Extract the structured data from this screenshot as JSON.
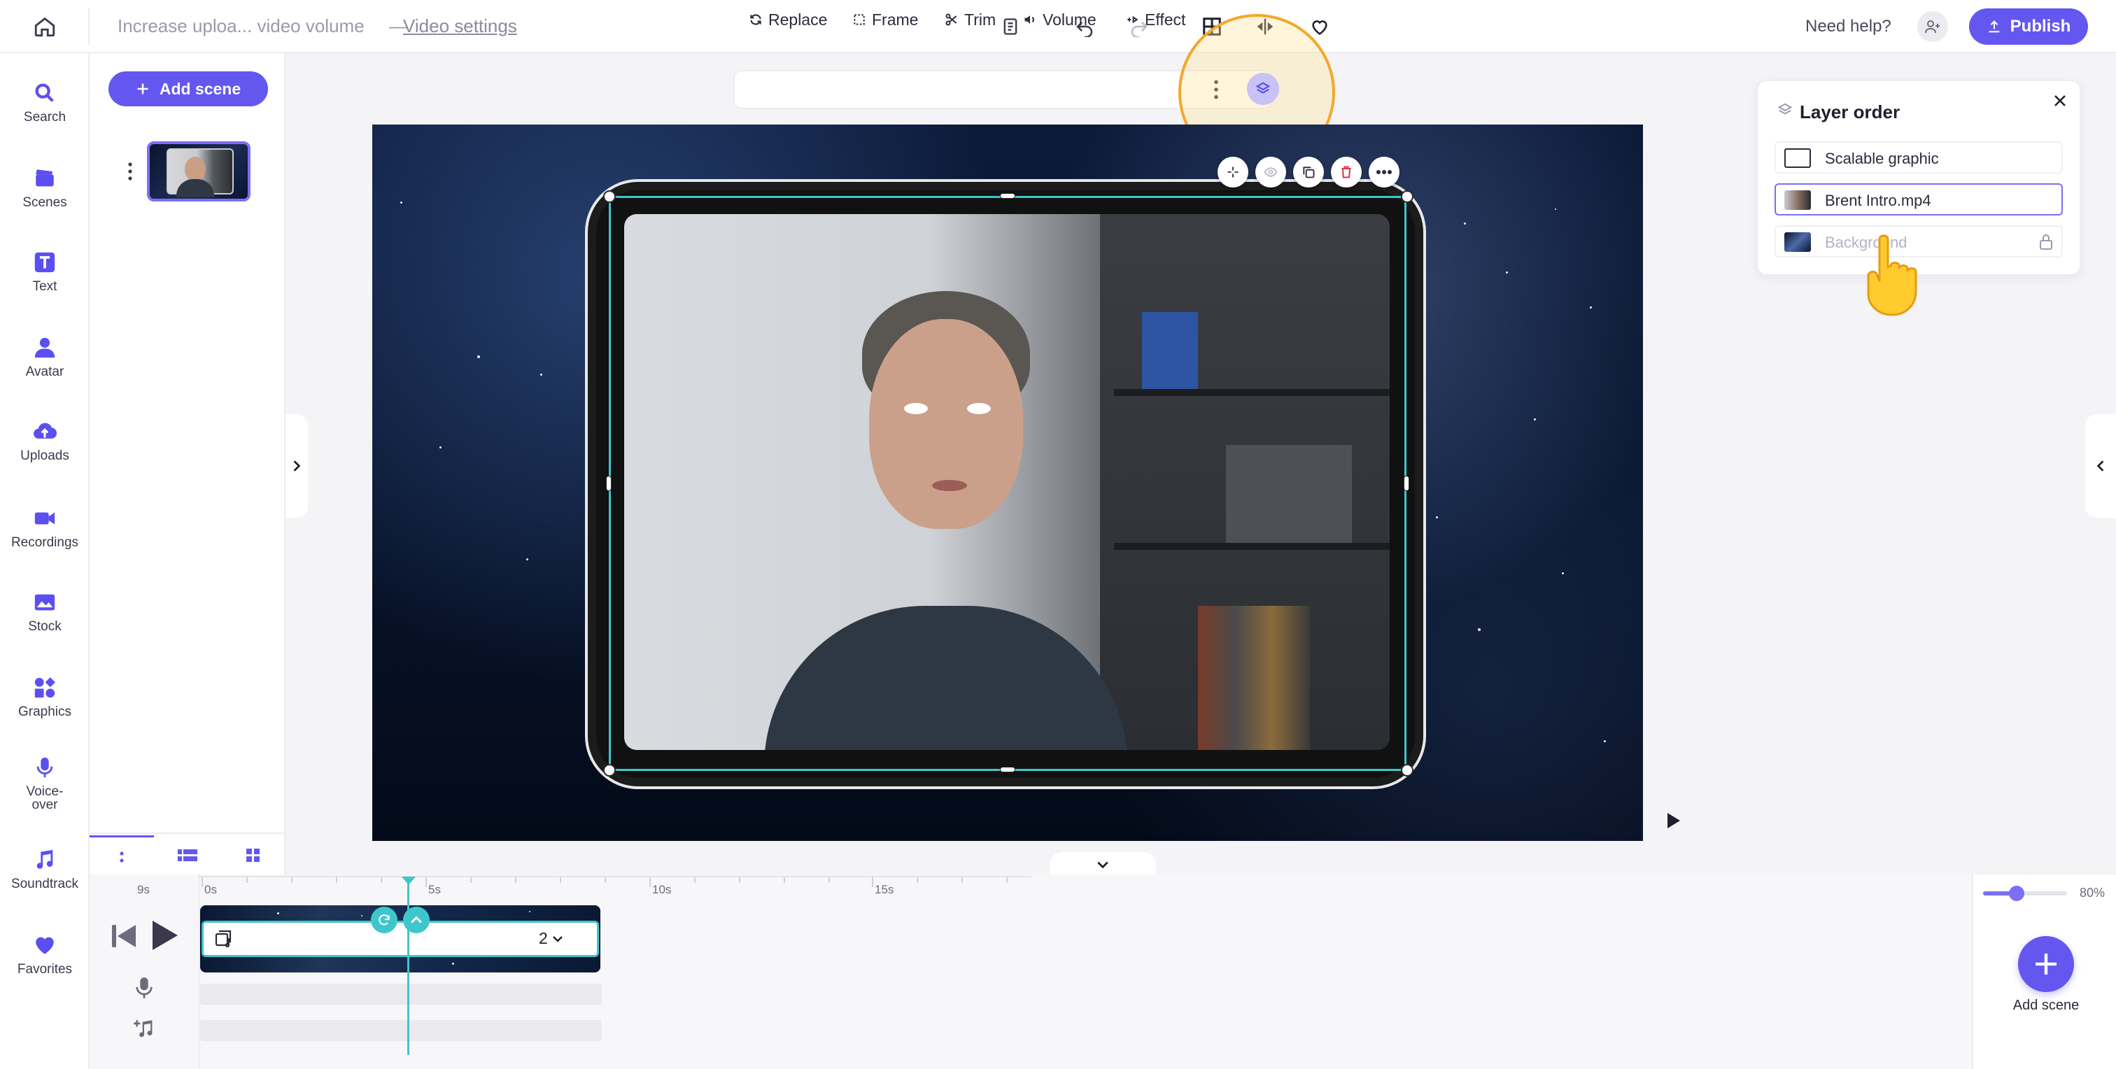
{
  "topbar": {
    "project_title": "Increase uploa... video volume",
    "dash": "—",
    "video_settings": "Video settings",
    "need_help": "Need help?",
    "publish": "Publish"
  },
  "left_rail": [
    {
      "label": "Search",
      "icon": "search-icon"
    },
    {
      "label": "Scenes",
      "icon": "scenes-icon"
    },
    {
      "label": "Text",
      "icon": "text-icon"
    },
    {
      "label": "Avatar",
      "icon": "avatar-icon"
    },
    {
      "label": "Uploads",
      "icon": "uploads-icon"
    },
    {
      "label": "Recordings",
      "icon": "recordings-icon"
    },
    {
      "label": "Stock",
      "icon": "stock-icon"
    },
    {
      "label": "Graphics",
      "icon": "graphics-icon"
    },
    {
      "label": "Voice-\nover",
      "icon": "voiceover-icon"
    },
    {
      "label": "Soundtrack",
      "icon": "soundtrack-icon"
    },
    {
      "label": "Favorites",
      "icon": "favorites-icon"
    }
  ],
  "scenes_panel": {
    "add_scene": "Add scene"
  },
  "toolbar": {
    "replace": "Replace",
    "frame": "Frame",
    "trim": "Trim",
    "volume": "Volume",
    "effect": "Effect"
  },
  "layer_panel": {
    "title": "Layer order",
    "layers": [
      {
        "label": "Scalable graphic",
        "selected": false,
        "locked": false
      },
      {
        "label": "Brent Intro.mp4",
        "selected": true,
        "locked": false
      },
      {
        "label": "Background",
        "selected": false,
        "locked": true
      }
    ]
  },
  "timeline": {
    "total": "9s",
    "ticks": [
      "0s",
      "5s",
      "10s",
      "15s"
    ],
    "clip_count": "2"
  },
  "zoom": {
    "label": "80%",
    "value": 0.8
  },
  "fab": {
    "label": "Add scene"
  },
  "colors": {
    "accent": "#6457f0",
    "selection": "#3fc6cc",
    "highlight": "#f3a82b"
  }
}
